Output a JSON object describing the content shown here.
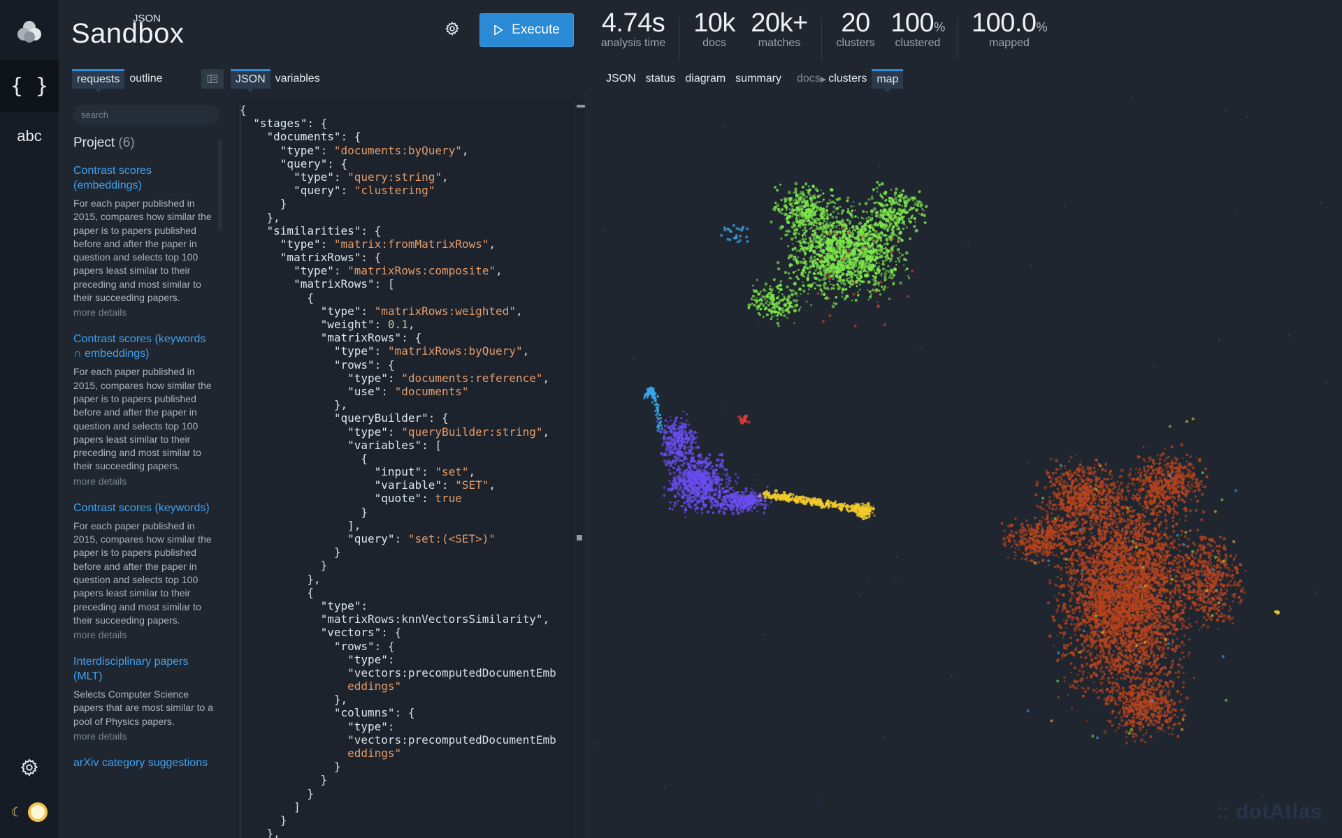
{
  "app": {
    "brand_sup": "JSON",
    "brand_main": "Sandbox",
    "execute_label": "Execute"
  },
  "stats": [
    {
      "value": "4.74s",
      "unit": "",
      "label": "analysis time"
    },
    {
      "value": "10k",
      "unit": "",
      "label": "docs"
    },
    {
      "value": "20k+",
      "unit": "",
      "label": "matches"
    },
    {
      "value": "20",
      "unit": "",
      "label": "clusters"
    },
    {
      "value": "100",
      "unit": "%",
      "label": "clustered"
    },
    {
      "value": "100.0",
      "unit": "%",
      "label": "mapped"
    }
  ],
  "rail": {
    "json_icon": "{ }",
    "abc_label": "abc"
  },
  "left_tabs": {
    "requests": "requests",
    "outline": "outline"
  },
  "mid_tabs": {
    "json": "JSON",
    "variables": "variables"
  },
  "right_tabs": {
    "json": "JSON",
    "status": "status",
    "diagram": "diagram",
    "summary": "summary",
    "docs": "docs",
    "clusters": "clusters",
    "map": "map"
  },
  "sidebar": {
    "search_placeholder": "search",
    "project_label": "Project",
    "project_count": "(6)",
    "requests": [
      {
        "title": "Contrast scores (embeddings)",
        "desc": "For each paper published in 2015, compares how similar the paper is to papers published before and after the paper in question and selects top 100 papers least similar to their preceding and most similar to their succeeding papers.",
        "more": "more details"
      },
      {
        "title": "Contrast scores (keywords ∩ embeddings)",
        "desc": "For each paper published in 2015, compares how similar the paper is to papers published before and after the paper in question and selects top 100 papers least similar to their preceding and most similar to their succeeding papers.",
        "more": "more details"
      },
      {
        "title": "Contrast scores (keywords)",
        "desc": "For each paper published in 2015, compares how similar the paper is to papers published before and after the paper in question and selects top 100 papers least similar to their preceding and most similar to their succeeding papers.",
        "more": "more details"
      },
      {
        "title": "Interdisciplinary papers (MLT)",
        "desc": "Selects Computer Science papers that are most similar to a pool of Physics papers.",
        "more": "more details"
      },
      {
        "title": "arXiv category suggestions",
        "desc": "",
        "more": ""
      }
    ]
  },
  "code_lines": [
    "{",
    "  \"stages\": {",
    "    \"documents\": {",
    "      \"type\": \"documents:byQuery\",",
    "      \"query\": {",
    "        \"type\": \"query:string\",",
    "        \"query\": \"clustering\"",
    "      }",
    "    },",
    "    \"similarities\": {",
    "      \"type\": \"matrix:fromMatrixRows\",",
    "      \"matrixRows\": {",
    "        \"type\": \"matrixRows:composite\",",
    "        \"matrixRows\": [",
    "          {",
    "            \"type\": \"matrixRows:weighted\",",
    "            \"weight\": 0.1,",
    "            \"matrixRows\": {",
    "              \"type\": \"matrixRows:byQuery\",",
    "              \"rows\": {",
    "                \"type\": \"documents:reference\",",
    "                \"use\": \"documents\"",
    "              },",
    "              \"queryBuilder\": {",
    "                \"type\": \"queryBuilder:string\",",
    "                \"variables\": [",
    "                  {",
    "                    \"input\": \"set\",",
    "                    \"variable\": \"SET\",",
    "                    \"quote\": true",
    "                  }",
    "                ],",
    "                \"query\": \"set:(<SET>)\"",
    "              }",
    "            }",
    "          },",
    "          {",
    "            \"type\":",
    "            \"matrixRows:knnVectorsSimilarity\",",
    "            \"vectors\": {",
    "              \"rows\": {",
    "                \"type\":",
    "                \"vectors:precomputedDocumentEmb",
    "                eddings\"",
    "              },",
    "              \"columns\": {",
    "                \"type\":",
    "                \"vectors:precomputedDocumentEmb",
    "                eddings\"",
    "              }",
    "            }",
    "          }",
    "        ]",
    "      }",
    "    },"
  ],
  "map": {
    "watermark": "dotAtlas",
    "colors": {
      "green": "#7de84a",
      "purple": "#6a4cf0",
      "blue": "#3aa7e8",
      "yellow": "#f2cb2a",
      "orange": "#b8431c",
      "red": "#e43a3a"
    }
  }
}
